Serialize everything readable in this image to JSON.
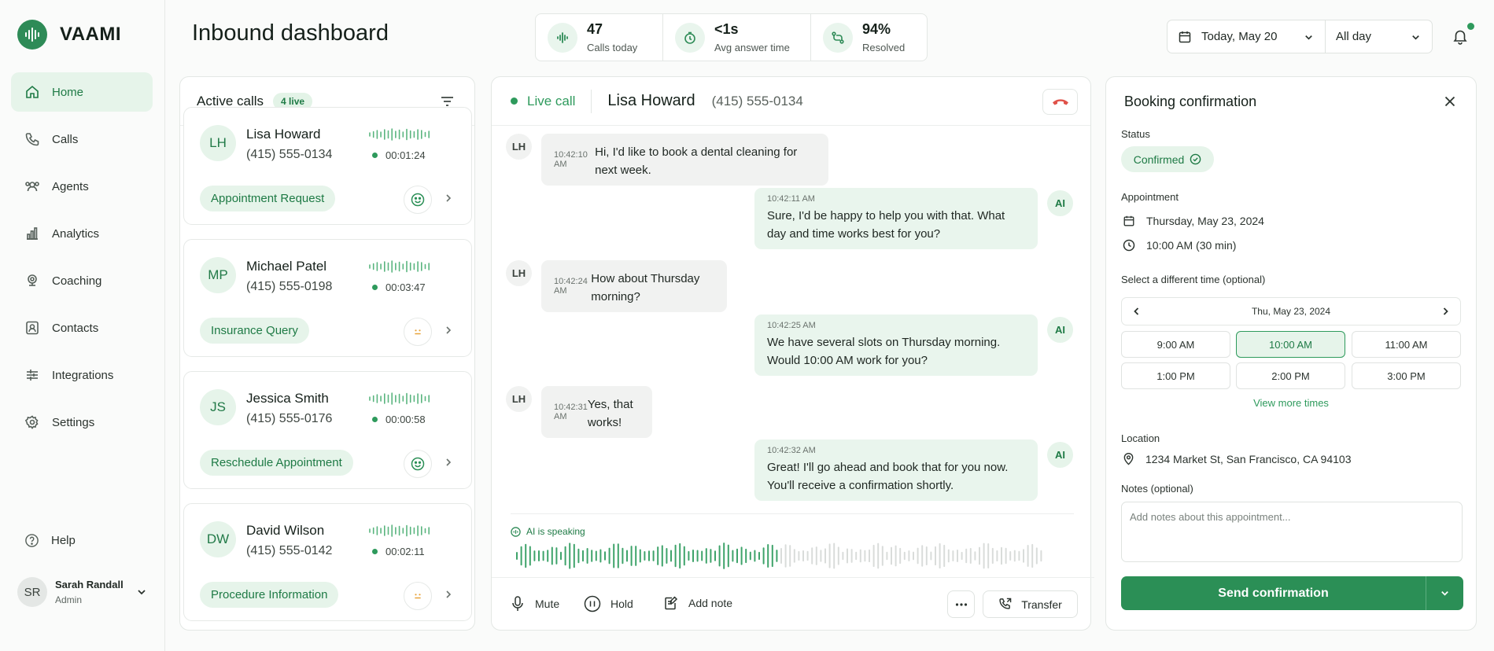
{
  "app": {
    "name": "VAAMI"
  },
  "sidebar": {
    "items": [
      {
        "label": "Home",
        "icon": "home-icon"
      },
      {
        "label": "Calls",
        "icon": "phone-icon"
      },
      {
        "label": "Agents",
        "icon": "users-icon"
      },
      {
        "label": "Analytics",
        "icon": "bar-chart-icon"
      },
      {
        "label": "Coaching",
        "icon": "coaching-icon"
      },
      {
        "label": "Contacts",
        "icon": "contacts-icon"
      },
      {
        "label": "Integrations",
        "icon": "integrations-icon"
      },
      {
        "label": "Settings",
        "icon": "gear-icon"
      }
    ],
    "active": "Home",
    "help_label": "Help",
    "user": {
      "initials": "SR",
      "name": "Sarah Randall",
      "role": "Admin"
    }
  },
  "header": {
    "title": "Inbound dashboard",
    "stats": [
      {
        "value": "47",
        "label": "Calls today",
        "icon": "waveform-icon"
      },
      {
        "value": "<1s",
        "label": "Avg answer time",
        "icon": "timer-icon"
      },
      {
        "value": "94%",
        "label": "Resolved",
        "icon": "resolved-icon"
      }
    ],
    "date_filter": "Today, May 20",
    "time_filter": "All day"
  },
  "active_calls": {
    "title": "Active calls",
    "badge": "4 live",
    "calls": [
      {
        "initials": "LH",
        "name": "Lisa Howard",
        "phone": "(415) 555-0134",
        "duration": "00:01:24",
        "tag": "Appointment Request",
        "sentiment": "happy"
      },
      {
        "initials": "MP",
        "name": "Michael Patel",
        "phone": "(415) 555-0198",
        "duration": "00:03:47",
        "tag": "Insurance Query",
        "sentiment": "neutral"
      },
      {
        "initials": "JS",
        "name": "Jessica Smith",
        "phone": "(415) 555-0176",
        "duration": "00:00:58",
        "tag": "Reschedule Appointment",
        "sentiment": "happy"
      },
      {
        "initials": "DW",
        "name": "David Wilson",
        "phone": "(415) 555-0142",
        "duration": "00:02:11",
        "tag": "Procedure Information",
        "sentiment": "neutral"
      }
    ]
  },
  "live_call": {
    "status": "Live call",
    "caller_name": "Lisa Howard",
    "caller_phone": "(415) 555-0134",
    "messages": [
      {
        "speaker": "LH",
        "time": "10:42:10 AM",
        "text": "Hi, I'd like to book a dental cleaning for next week."
      },
      {
        "speaker": "AI",
        "time": "10:42:11 AM",
        "text": "Sure, I'd be happy to help you with that. What day and time works best for you?"
      },
      {
        "speaker": "LH",
        "time": "10:42:24 AM",
        "text": "How about Thursday morning?"
      },
      {
        "speaker": "AI",
        "time": "10:42:25 AM",
        "text": "We have several slots on Thursday morning. Would 10:00 AM work for you?"
      },
      {
        "speaker": "LH",
        "time": "10:42:31 AM",
        "text": "Yes, that works!"
      },
      {
        "speaker": "AI",
        "time": "10:42:32 AM",
        "text": "Great! I'll go ahead and book that for you now. You'll receive a confirmation shortly."
      }
    ],
    "speaking_label": "AI is speaking",
    "controls": {
      "mute": "Mute",
      "hold": "Hold",
      "add_note": "Add note",
      "transfer": "Transfer"
    }
  },
  "booking": {
    "title": "Booking confirmation",
    "status_label": "Status",
    "status_value": "Confirmed",
    "appointment_label": "Appointment",
    "appointment_date": "Thursday, May 23, 2024",
    "appointment_time": "10:00 AM (30 min)",
    "select_label": "Select a different time (optional)",
    "calendar_date": "Thu, May 23, 2024",
    "slots": [
      "9:00 AM",
      "10:00 AM",
      "11:00 AM",
      "1:00 PM",
      "2:00 PM",
      "3:00 PM"
    ],
    "selected_slot": "10:00 AM",
    "view_more": "View more times",
    "location_label": "Location",
    "location": "1234 Market St, San Francisco, CA 94103",
    "notes_label": "Notes (optional)",
    "notes_placeholder": "Add notes about this appointment...",
    "send_label": "Send confirmation"
  },
  "colors": {
    "accent": "#2b8f56",
    "accent_light": "#e6f4ea",
    "neutral_sentiment": "#e8a33a",
    "hangup": "#e0524a"
  }
}
